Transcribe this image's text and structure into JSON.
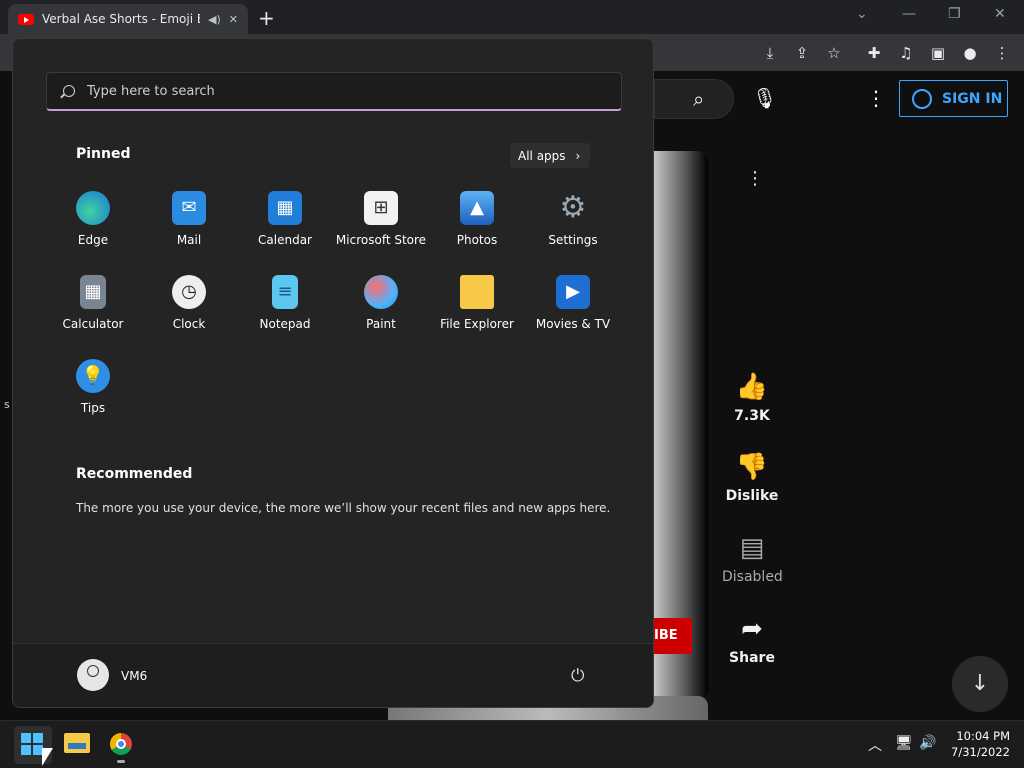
{
  "browser": {
    "tab_title": "Verbal Ase Shorts - Emoji Be",
    "new_tab": "+",
    "window_controls": [
      "⌄",
      "—",
      "❐",
      "✕"
    ],
    "toolbar_icons": [
      "download-icon",
      "share-icon",
      "star-icon",
      "extensions-icon",
      "media-icon",
      "sidepanel-icon",
      "profile-icon",
      "menu-icon"
    ]
  },
  "youtube": {
    "sign_in": "SIGN IN",
    "subscribe_partial": "IBE",
    "likes": "7.3K",
    "dislike": "Dislike",
    "comments": "Disabled",
    "share": "Share",
    "left_edge_text": "s"
  },
  "start_menu": {
    "search_placeholder": "Type here to search",
    "pinned_heading": "Pinned",
    "all_apps": "All apps",
    "apps": [
      {
        "label": "Edge"
      },
      {
        "label": "Mail"
      },
      {
        "label": "Calendar"
      },
      {
        "label": "Microsoft Store"
      },
      {
        "label": "Photos"
      },
      {
        "label": "Settings"
      },
      {
        "label": "Calculator"
      },
      {
        "label": "Clock"
      },
      {
        "label": "Notepad"
      },
      {
        "label": "Paint"
      },
      {
        "label": "File Explorer"
      },
      {
        "label": "Movies & TV"
      },
      {
        "label": "Tips"
      }
    ],
    "recommended_heading": "Recommended",
    "recommended_text": "The more you use your device, the more we’ll show your recent files and new apps here.",
    "user_name": "VM6"
  },
  "taskbar": {
    "time": "10:04 PM",
    "date": "7/31/2022"
  },
  "colors": {
    "accent": "#4cc2ff",
    "search_underline": "#c59bd6",
    "youtube_blue": "#3ea6ff",
    "youtube_red": "#cc0000"
  }
}
